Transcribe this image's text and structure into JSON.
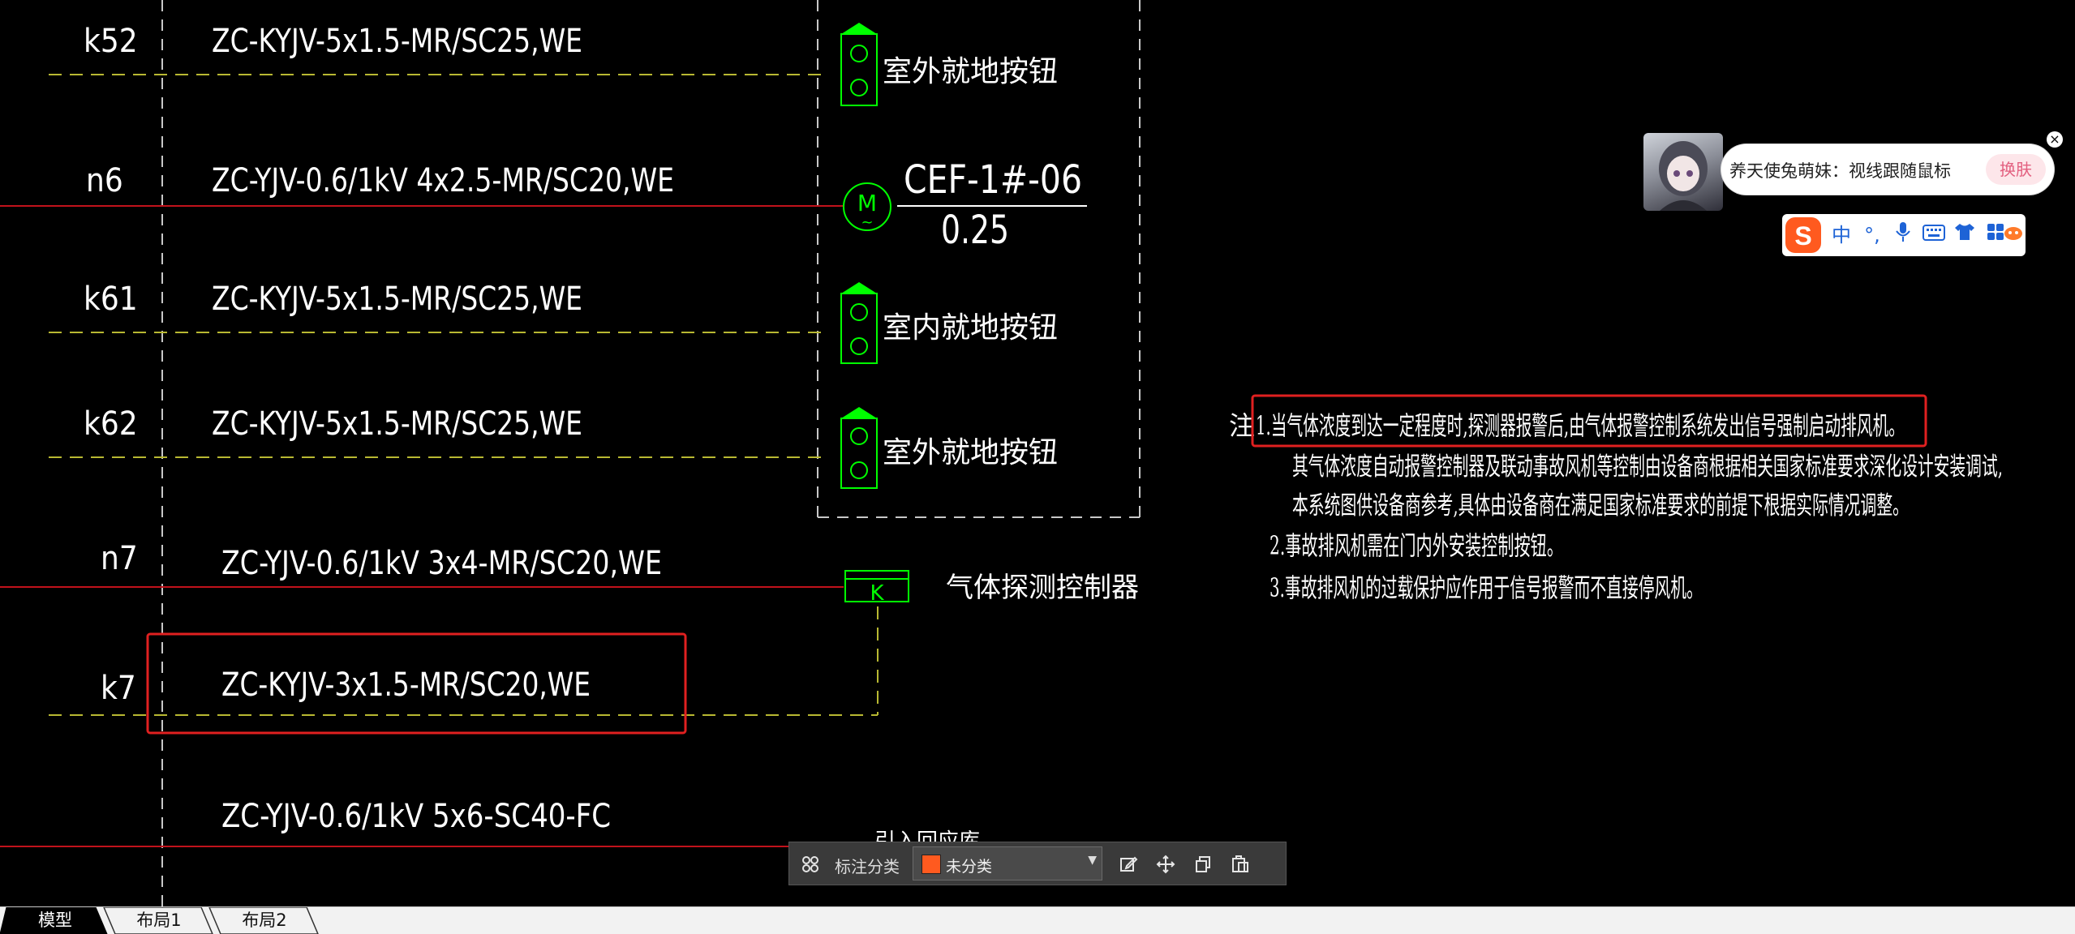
{
  "schematic": {
    "circuits": [
      {
        "id": "k52",
        "cable": "ZC-KYJV-5x1.5-MR/SC25,WE",
        "device": "室外就地按钮"
      },
      {
        "id": "n6",
        "cable": "ZC-YJV-0.6/1kV 4x2.5-MR/SC20,WE",
        "motor_label": "M",
        "motor_tag": "CEF-1#-06",
        "motor_power": "0.25"
      },
      {
        "id": "k61",
        "cable": "ZC-KYJV-5x1.5-MR/SC25,WE",
        "device": "室内就地按钮"
      },
      {
        "id": "k62",
        "cable": "ZC-KYJV-5x1.5-MR/SC25,WE",
        "device": "室外就地按钮"
      },
      {
        "id": "n7",
        "cable": "ZC-YJV-0.6/1kV 3x4-MR/SC20,WE",
        "device_symbol": "K",
        "device": "气体探测控制器"
      },
      {
        "id": "k7",
        "cable": "ZC-KYJV-3x1.5-MR/SC20,WE"
      },
      {
        "id": "",
        "cable": "ZC-YJV-0.6/1kV 5x6-SC40-FC",
        "partial_text": "引入回应库"
      }
    ],
    "notes": {
      "prefix": "注",
      "lines": [
        "1.当气体浓度到达一定程度时,探测器报警后,由气体报警控制系统发出信号强制启动排风机。",
        "其气体浓度自动报警控制器及联动事故风机等控制由设备商根据相关国家标准要求深化设计安装调试,",
        "本系统图供设备商参考,具体由设备商在满足国家标准要求的前提下根据实际情况调整。",
        "2.事故排风机需在门内外安装控制按钮。",
        "3.事故排风机的过载保护应作用于信号报警而不直接停风机。"
      ]
    },
    "colors": {
      "white_text": "#ffffff",
      "yellow_dash": "#b8b832",
      "red_line": "#c1121b",
      "green_symbol": "#00ff00",
      "highlight_box": "#e02020"
    }
  },
  "toolbar": {
    "grid_icon": "grid-icon",
    "label": "标注分类",
    "select_value": "未分类",
    "swatch_color": "#ff5a1f",
    "actions": [
      "edit-icon",
      "move-icon",
      "copy-icon",
      "paste-icon"
    ]
  },
  "tabs": [
    {
      "label": "模型",
      "active": true
    },
    {
      "label": "布局1",
      "active": false
    },
    {
      "label": "布局2",
      "active": false
    }
  ],
  "widget": {
    "bubble_text": "养天使兔萌妹：视线跟随鼠标",
    "skin_button": "换肤",
    "close": "×"
  },
  "ime_bar": {
    "logo": "S",
    "mode": "中",
    "punct": "°,",
    "items": [
      "mic-icon",
      "keyboard-icon",
      "shirt-icon",
      "apps-icon",
      "mascot-icon"
    ]
  }
}
